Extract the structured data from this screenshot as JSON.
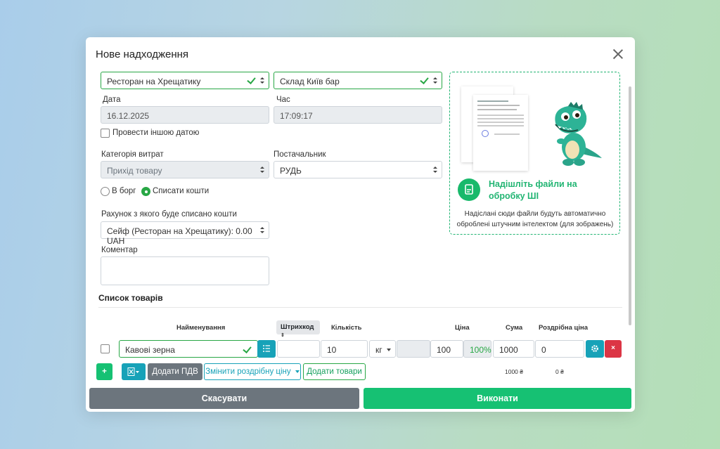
{
  "modal": {
    "title": "Нове надходження"
  },
  "form": {
    "restaurant": "Ресторан на Хрещатику",
    "warehouse": "Склад Київ бар",
    "date_label": "Дата",
    "date_value": "16.12.2025",
    "time_label": "Час",
    "time_value": "17:09:17",
    "other_date_label": "Провести іншою датою",
    "expense_category_label": "Категорія витрат",
    "expense_category_value": "Прихід товару",
    "supplier_label": "Постачальник",
    "supplier_value": "РУДЬ",
    "payment_options": [
      "В борг",
      "Списати кошти"
    ],
    "selected_payment": "Списати кошти",
    "account_label": "Рахунок з якого буде списано кошти",
    "account_value": "Сейф (Ресторан на Хрещатику): 0.00 UAH",
    "comment_label": "Коментар",
    "comment_value": ""
  },
  "dropzone": {
    "title": "Надішліть файли на обробку ШІ",
    "subtitle": "Надіслані сюди файли будуть автоматично оброблені штучним інтелектом (для зображень)"
  },
  "items": {
    "section_title": "Список товарів",
    "columns": {
      "name": "Найменування",
      "barcode": "Штрихкод",
      "qty": "Кількість",
      "price": "Ціна",
      "sum": "Сума",
      "retail": "Роздрібна ціна"
    },
    "rows": [
      {
        "name": "Кавові зерна",
        "barcode": "",
        "qty": "10",
        "unit": "кг",
        "price": "100",
        "percent": "100%",
        "sum": "1000",
        "retail": "0"
      }
    ],
    "totals": {
      "sum": "1000 ₴",
      "retail": "0 ₴"
    },
    "buttons": {
      "add": "+",
      "add_vat": "Додати ПДВ",
      "change_retail": "Змінити роздрібну ціну",
      "add_goods": "Додати товари"
    }
  },
  "footer": {
    "cancel": "Скасувати",
    "submit": "Виконати"
  },
  "colors": {
    "green": "#16c173",
    "teal": "#17a2b8",
    "red": "#dc3545",
    "gray": "#6c757d"
  }
}
